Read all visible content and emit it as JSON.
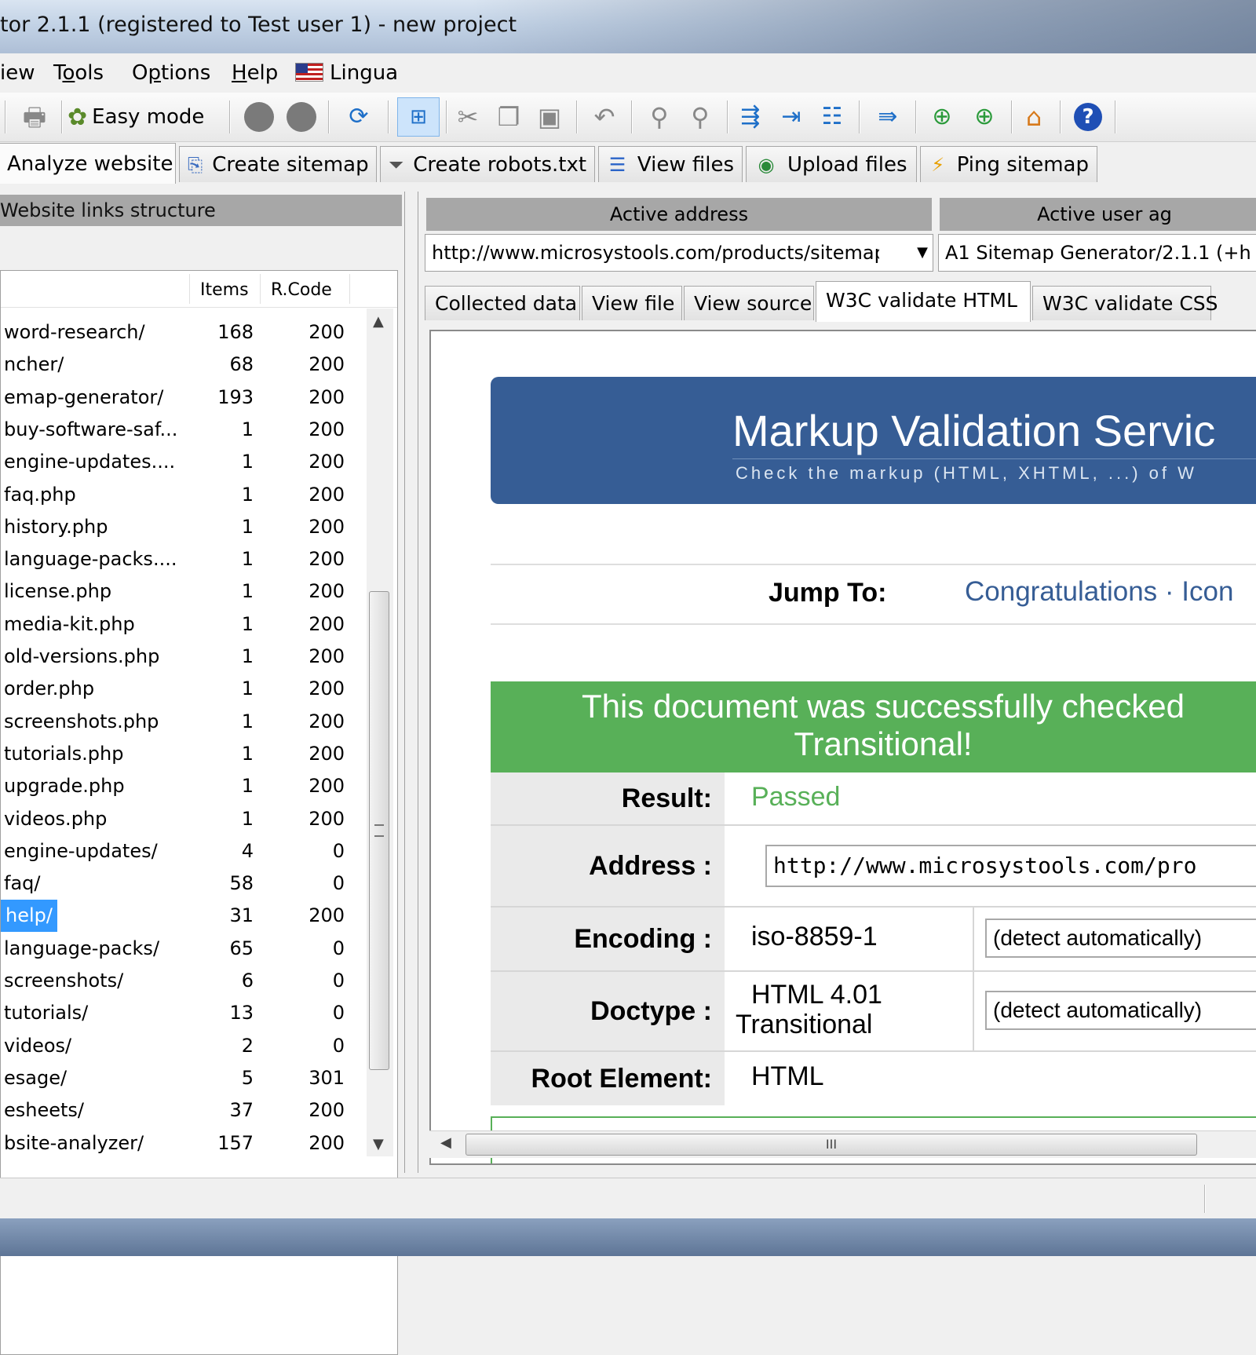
{
  "window": {
    "title": "tor 2.1.1 (registered to Test user 1) - new project"
  },
  "menu": [
    {
      "label": "iew",
      "underline": ""
    },
    {
      "label": "Tools",
      "underline": "o"
    },
    {
      "label": "Options",
      "underline": "p"
    },
    {
      "label": "Help",
      "underline": "H"
    },
    {
      "label": "Lingua",
      "icon": "flag-icon"
    }
  ],
  "toolbar": {
    "easy_mode_label": "Easy mode"
  },
  "main_tabs": [
    {
      "label": "Analyze website",
      "icon": "analyze-icon"
    },
    {
      "label": "Create sitemap",
      "icon": "sitemap-icon"
    },
    {
      "label": "Create robots.txt",
      "icon": "funnel-icon"
    },
    {
      "label": "View files",
      "icon": "list-icon"
    },
    {
      "label": "Upload files",
      "icon": "globe-icon"
    },
    {
      "label": "Ping sitemap",
      "icon": "lightning-icon"
    }
  ],
  "left_panel": {
    "header": "Website links structure",
    "columns": {
      "items": "Items",
      "rcode": "R.Code"
    },
    "rows": [
      {
        "name": "word-research/",
        "items": "168",
        "rcode": "200"
      },
      {
        "name": "ncher/",
        "items": "68",
        "rcode": "200"
      },
      {
        "name": "emap-generator/",
        "items": "193",
        "rcode": "200"
      },
      {
        "name": "buy-software-saf...",
        "items": "1",
        "rcode": "200"
      },
      {
        "name": "engine-updates....",
        "items": "1",
        "rcode": "200"
      },
      {
        "name": "faq.php",
        "items": "1",
        "rcode": "200"
      },
      {
        "name": "history.php",
        "items": "1",
        "rcode": "200"
      },
      {
        "name": "language-packs....",
        "items": "1",
        "rcode": "200"
      },
      {
        "name": "license.php",
        "items": "1",
        "rcode": "200"
      },
      {
        "name": "media-kit.php",
        "items": "1",
        "rcode": "200"
      },
      {
        "name": "old-versions.php",
        "items": "1",
        "rcode": "200"
      },
      {
        "name": "order.php",
        "items": "1",
        "rcode": "200"
      },
      {
        "name": "screenshots.php",
        "items": "1",
        "rcode": "200"
      },
      {
        "name": "tutorials.php",
        "items": "1",
        "rcode": "200"
      },
      {
        "name": "upgrade.php",
        "items": "1",
        "rcode": "200"
      },
      {
        "name": "videos.php",
        "items": "1",
        "rcode": "200"
      },
      {
        "name": "engine-updates/",
        "items": "4",
        "rcode": "0"
      },
      {
        "name": "faq/",
        "items": "58",
        "rcode": "0"
      },
      {
        "name": "help/",
        "items": "31",
        "rcode": "200",
        "selected": true
      },
      {
        "name": "language-packs/",
        "items": "65",
        "rcode": "0"
      },
      {
        "name": "screenshots/",
        "items": "6",
        "rcode": "0"
      },
      {
        "name": "tutorials/",
        "items": "13",
        "rcode": "0"
      },
      {
        "name": "videos/",
        "items": "2",
        "rcode": "0"
      },
      {
        "name": "esage/",
        "items": "5",
        "rcode": "301"
      },
      {
        "name": "esheets/",
        "items": "37",
        "rcode": "200"
      },
      {
        "name": "bsite-analyzer/",
        "items": "157",
        "rcode": "200"
      }
    ]
  },
  "right_panel": {
    "active_address_label": "Active address",
    "active_address_value": "http://www.microsystools.com/products/sitemap",
    "active_user_agent_label": "Active user ag",
    "active_user_agent_value": "A1 Sitemap Generator/2.1.1 (+h",
    "sub_tabs": [
      {
        "label": "Collected data"
      },
      {
        "label": "View file"
      },
      {
        "label": "View source"
      },
      {
        "label": "W3C validate HTML",
        "active": true
      },
      {
        "label": "W3C validate CSS"
      }
    ]
  },
  "w3c": {
    "title": "Markup Validation Servic",
    "subtitle": "Check the markup (HTML, XHTML, ...) of W",
    "jump_to_label": "Jump To:",
    "jump_links": "Congratulations · Icon",
    "success_line1": "This document was successfully checked",
    "success_line2": "Transitional!",
    "result_label": "Result:",
    "result_value": "Passed",
    "address_label": "Address :",
    "address_value": "http://www.microsystools.com/pro",
    "encoding_label": "Encoding :",
    "encoding_value": "iso-8859-1",
    "encoding_select": "(detect automatically)",
    "doctype_label": "Doctype :",
    "doctype_value_1": "HTML 4.01",
    "doctype_value_2": "Transitional",
    "doctype_select": "(detect automatically)",
    "root_label": "Root Element:",
    "root_value": "HTML",
    "colors": {
      "banner": "#365d95",
      "success": "#58b058",
      "passed": "#58b058"
    }
  }
}
